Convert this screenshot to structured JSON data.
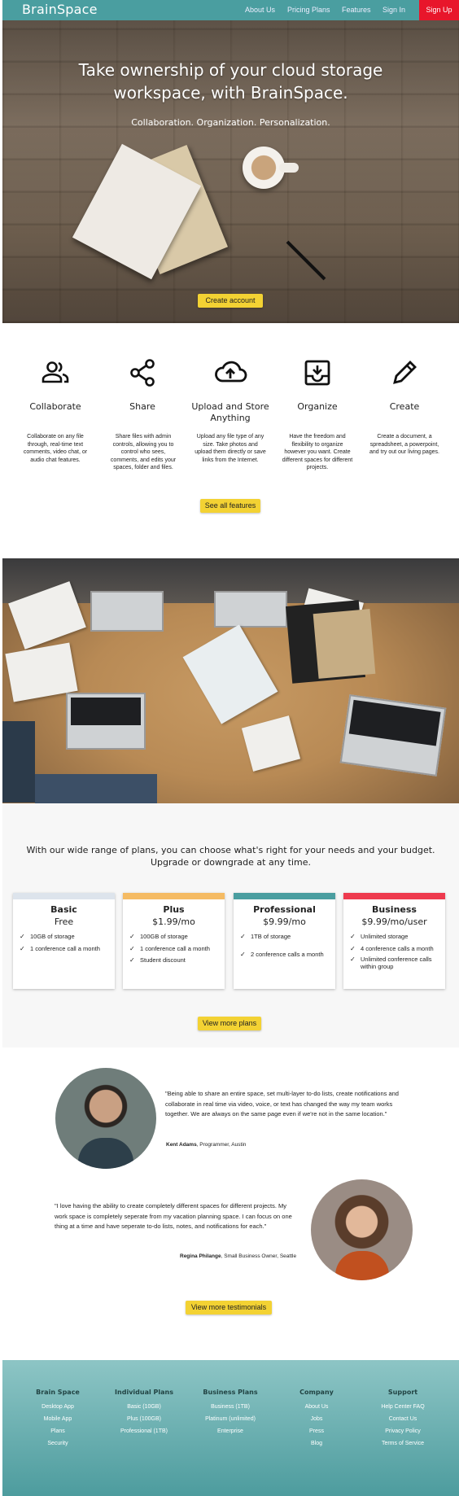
{
  "nav": {
    "logo": "BrainSpace",
    "links": [
      "About Us",
      "Pricing Plans",
      "Features",
      "Sign In"
    ],
    "signup": "Sign Up"
  },
  "hero": {
    "title_line1": "Take ownership of your cloud storage",
    "title_line2": "workspace, with BrainSpace.",
    "subtitle": "Collaboration. Organization. Personalization.",
    "cta": "Create account"
  },
  "features": {
    "items": [
      {
        "icon": "people-icon",
        "title": "Collaborate",
        "title2": "",
        "desc": "Collaborate on any file through, real-time text comments, video chat, or audio chat features."
      },
      {
        "icon": "share-icon",
        "title": "Share",
        "title2": "",
        "desc": "Share files with admin controls, allowing you to control who sees, comments, and edits your spaces, folder and files."
      },
      {
        "icon": "cloud-upload-icon",
        "title": "Upload and Store",
        "title2": "Anything",
        "desc": "Upload any file type of any size. Take photos and upload them directly or save links from the Internet."
      },
      {
        "icon": "inbox-download-icon",
        "title": "Organize",
        "title2": "",
        "desc": "Have the freedom and flexibility to organize however you want. Create different spaces for different projects."
      },
      {
        "icon": "pencil-icon",
        "title": "Create",
        "title2": "",
        "desc": "Create a document, a spreadsheet, a powerpoint, and try out our living pages."
      }
    ],
    "cta": "See all features"
  },
  "plans": {
    "intro_line1": "With our wide range of plans, you can choose what's right for your needs and your budget.",
    "intro_line2": "Upgrade or downgrade at any time.",
    "cards": [
      {
        "name": "Basic",
        "price": "Free",
        "color": "#dde4ec",
        "features": [
          "10GB of storage",
          "1 conference call a month"
        ]
      },
      {
        "name": "Plus",
        "price": "$1.99/mo",
        "color": "#f5bb63",
        "features": [
          "100GB of storage",
          "1 conference call a month",
          "Student discount"
        ]
      },
      {
        "name": "Professional",
        "price": "$9.99/mo",
        "color": "#4a9ea0",
        "features": [
          "1TB of storage",
          "2 conference calls a month"
        ]
      },
      {
        "name": "Business",
        "price": "$9.99/mo/user",
        "color": "#ee3a4e",
        "features": [
          "Unlimited storage",
          "4 conference calls a month",
          "Unlimited conference calls within group"
        ]
      }
    ],
    "cta": "View more plans"
  },
  "testimonials": {
    "items": [
      {
        "quote": "\"Being able to share an entire space, set multi-layer to-do lists, create notifications and collaborate in real time via video, voice, or text has changed the way my team works together. We are always on the same page even if we're not in the same location.\"",
        "name": "Kent Adams",
        "role": ", Programmer, Austin"
      },
      {
        "quote": "\"I love having the ability to create completely different spaces for different projects. My work space is completely seperate from my vacation planning space. I can focus on one thing at a time and have seperate to-do lists, notes, and notifications for each.\"",
        "name": "Regina Philange",
        "role": ", Small Business Owner, Seattle"
      }
    ],
    "cta": "View more testimonials"
  },
  "footer": {
    "columns": [
      {
        "title": "Brain Space",
        "links": [
          "Desktop App",
          "Mobile App",
          "Plans",
          "Security"
        ]
      },
      {
        "title": "Individual Plans",
        "links": [
          "Basic (10GB)",
          "Plus (100GB)",
          "Professional (1TB)"
        ]
      },
      {
        "title": "Business Plans",
        "links": [
          "Business (1TB)",
          "Platinum (unlimited)",
          "Enterprise"
        ]
      },
      {
        "title": "Company",
        "links": [
          "About Us",
          "Jobs",
          "Press",
          "Blog"
        ]
      },
      {
        "title": "Support",
        "links": [
          "Help Center FAQ",
          "Contact Us",
          "Privacy Policy",
          "Terms of Service"
        ]
      }
    ]
  },
  "colors": {
    "brand_teal": "#4a9ea0",
    "signup_red": "#e8162b",
    "cta_yellow": "#f3d233"
  }
}
